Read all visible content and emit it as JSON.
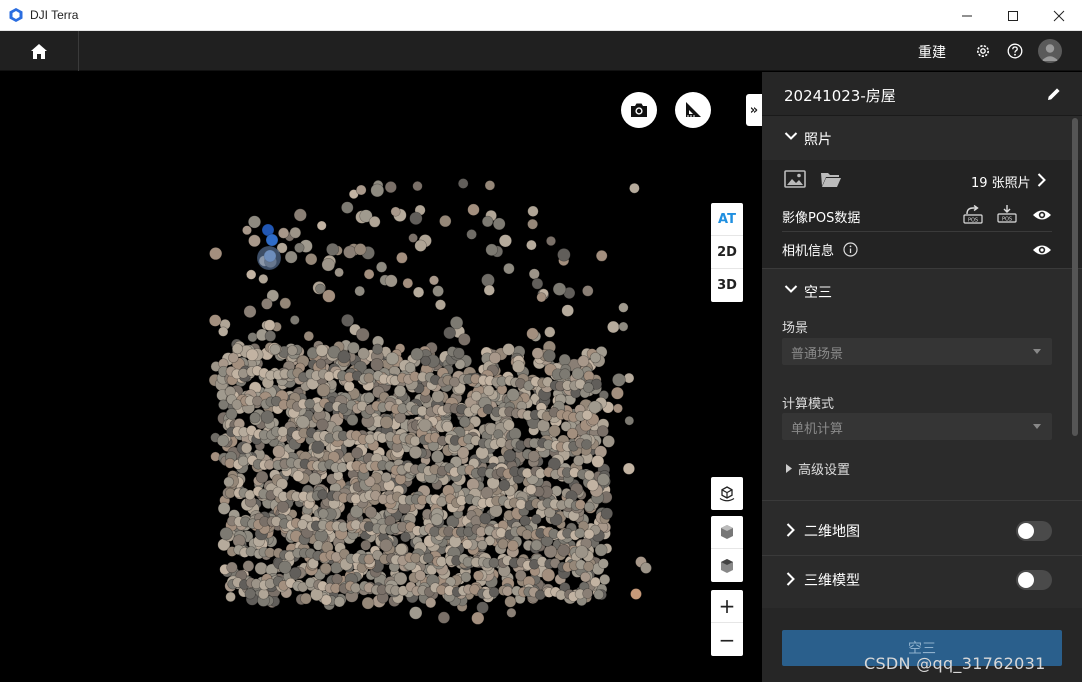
{
  "window": {
    "title": "DJI Terra"
  },
  "header": {
    "rebuild_label": "重建"
  },
  "project": {
    "name": "20241023-房屋"
  },
  "photos": {
    "section_title": "照片",
    "count_label": "19 张照片",
    "pos_label": "影像POS数据",
    "camera_label": "相机信息"
  },
  "aerotri": {
    "section_title": "空三",
    "scene_label": "场景",
    "scene_value": "普通场景",
    "compute_label": "计算模式",
    "compute_value": "单机计算",
    "advanced_label": "高级设置"
  },
  "map2d": {
    "title": "二维地图",
    "enabled": false
  },
  "model3d": {
    "title": "三维模型",
    "enabled": false
  },
  "actions": {
    "run_label": "空三"
  },
  "view_modes": {
    "at": "AT",
    "d2": "2D",
    "d3": "3D",
    "active": "AT"
  },
  "zoom": {
    "in": "+",
    "out": "−"
  },
  "watermark": "CSDN @qq_31762031",
  "icons": {
    "app": "dji-terra-logo-icon",
    "minimize": "minimize-icon",
    "maximize": "maximize-icon",
    "close": "close-icon",
    "home": "home-icon",
    "settings": "gear-icon",
    "help": "help-icon",
    "user": "user-avatar-icon",
    "camera": "camera-icon",
    "measure": "ruler-triangle-icon",
    "edit": "pencil-icon"
  },
  "colors": {
    "accent": "#1f8fe0",
    "run_button": "#2a5f8c",
    "panel_bg": "#2b2b2b",
    "viewport_bg": "#000000"
  }
}
